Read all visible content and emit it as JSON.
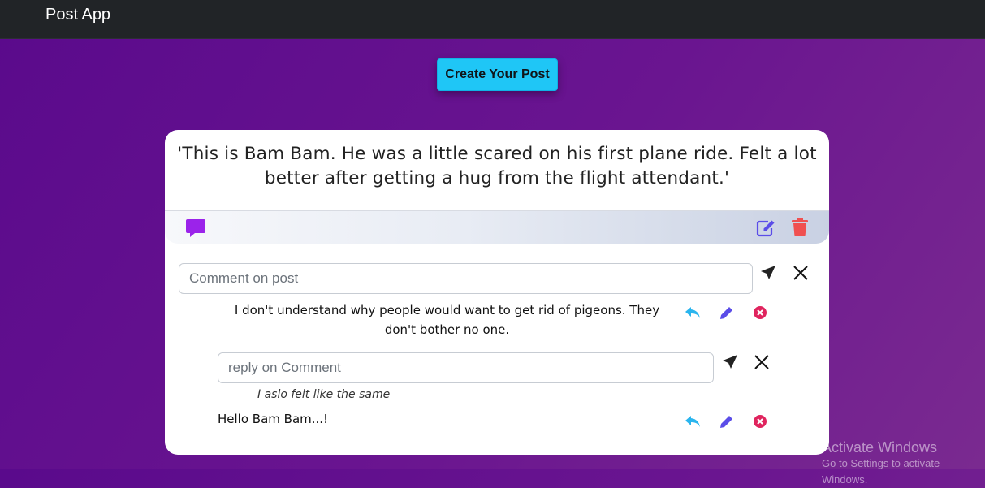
{
  "app": {
    "title": "Post App"
  },
  "toolbar": {
    "create_label": "Create Your Post"
  },
  "post": {
    "text": "'This is Bam Bam. He was a little scared on his first plane ride. Felt a lot better after getting a hug from the flight attendant.'",
    "icons": [
      "comment-icon",
      "edit-icon",
      "trash-icon"
    ]
  },
  "comment_form": {
    "placeholder": "Comment on post",
    "value": ""
  },
  "comments": [
    {
      "text": "I don't understand why people would want to get rid of pigeons. They don't bother no one.",
      "reply_form": {
        "placeholder": "reply on Comment",
        "value": ""
      },
      "replies": [
        "I aslo felt like the same"
      ]
    },
    {
      "text": "Hello Bam Bam...!"
    }
  ],
  "watermark": {
    "line1": "Activate Windows",
    "line2": "Go to Settings to activate Windows."
  },
  "colors": {
    "accent": "#1fc6f6",
    "comment_icon": "#9b23ea",
    "edit_icon": "#5b4de8",
    "delete_icon": "#f05050",
    "reply_icon": "#2ab5ee",
    "remove_icon": "#e0245e"
  }
}
